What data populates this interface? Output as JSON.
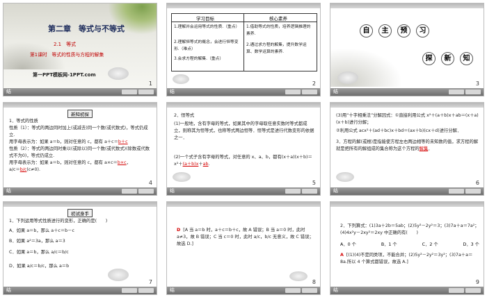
{
  "common": {
    "bar_left": "结",
    "colors": {
      "accent_red": "#d40000",
      "bar_gray": "#7a7a7a"
    }
  },
  "slides": [
    {
      "num": "1",
      "chapter": "第二章　等式与不等式",
      "section": "2.1　等式",
      "lesson": "第1课时　等式的性质与方程的解集",
      "site": "第一PPT模板网-1PPT.com"
    },
    {
      "num": "2",
      "h1": "学习目标",
      "h2": "核心素养",
      "l1": "1.理解并会运用等式的性质.（重点）",
      "l2": "2.理解恒等式的概念，会进行恒等变形.（难点）",
      "l3": "3.会求方程的解集.（重点）",
      "r1": "1.借助等式的性质，培养逻辑推理的素养.",
      "r2": "2.通过求方程的解集，提升数学运算、数学运算的素养."
    },
    {
      "num": "3",
      "c1": "自",
      "c2": "主",
      "c3": "预",
      "c4": "习",
      "c5": "探",
      "c6": "新",
      "c7": "知"
    },
    {
      "num": "4",
      "tag": "新知初探",
      "t1": "1．等式的性质",
      "t2": "性质（1）：等式的两边同时加上(或减去)同一个数(或代数式)，等式仍成立.",
      "t3": "用字母表示为：如果 a＝b，则对任意的 c，都有 a＋c＝",
      "a1": "b＋c",
      "t4": "性质（2）：等式的两边同时乘以(或除以)同一个数(或代数式)(除数或代数式不为0)，等式仍成立.",
      "t5": "用字母表示为：如果 a＝b，则对任意的 c，都有 a×c＝",
      "a2": "b×c",
      "t6": "，",
      "a3": "a/c＝",
      "a4": "b/c",
      "t7": "(c≠0)."
    },
    {
      "num": "5",
      "t1": "2．恒等式",
      "t2": "(1)一般地，含有字母的等式，如果其中的字母取任意实数时等式都成立，则称其为恒等式，也称等式两边恒等．恒等式是进行代数变形的依据之一．",
      "t3": "(2)一个式子含有字母的等式，对任意的 x、a、b，都有(x＋a)(x＋b)＝x²＋",
      "a1": "(a＋b)x",
      "t4": "＋",
      "a2": "ab",
      "t5": "."
    },
    {
      "num": "6",
      "t1": "(3)用“十字相乘法”分解因式：①直接利用公式 x²＋(a＋b)x＋ab＝(x＋a)(x＋b)进行分解；",
      "t2": "②利用公式 acx²＋(ad＋bc)x＋bd＝(ax＋b)(cx＋d)进行分解．",
      "t3": "3．方程的解(或根)是指能使方程左右两边相等的未知数的值，求方程的解就是把所有的解组成的集合称为这个方程的",
      "a1": "解集",
      "t4": "．"
    },
    {
      "num": "7",
      "tag": "初试身手",
      "q": "1．下列运用等式性质进行的变形，正确的是(　　)",
      "A": "A．如果 a＝b，那么 a＋c＝b－c",
      "B": "B．如果 a²＝3a，那么 a＝3",
      "C": "C．如果 a＝b，那么 a/c＝b/c",
      "D": "D．如果 a/c＝b/c，那么 a＝b"
    },
    {
      "num": "8",
      "ans": "D",
      "t1": "[A 当 a＝b 时，a＋c＝b＋c，故 A 错误；B 当 a＝0 时，此时 a≠3，故 B 错误；C 当 c＝0 时，此时 a/c，b/c 无意义，故 C 错误；故选 D.]"
    },
    {
      "num": "9",
      "q": "2．下列算式：(1)3a＋2b＝5ab；(2)5y²－2y²＝3；(3)7a＋a＝7a²；(4)4x²y－2xy²＝2xy 中正确的有(　　)",
      "A": "A．0 个",
      "B": "B．1 个",
      "C": "C．2 个",
      "D": "D．3 个",
      "ans": "A",
      "t1": "[(1)(4)不是同类项，不能合并；(2)5y²－2y²＝3y²；(3)7a＋a＝8a.所以 4 个算式都错误，故选 A.]"
    }
  ]
}
